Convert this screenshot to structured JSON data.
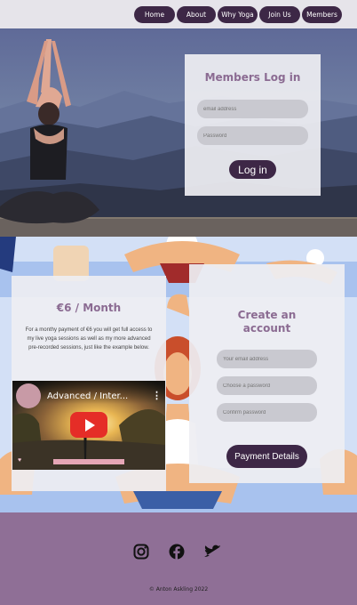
{
  "nav": {
    "items": [
      {
        "label": "Home"
      },
      {
        "label": "About"
      },
      {
        "label": "Why Yoga"
      },
      {
        "label": "Join Us"
      },
      {
        "label": "Members"
      }
    ]
  },
  "login": {
    "title": "Members Log in",
    "email_placeholder": "email address",
    "password_placeholder": "Password",
    "button_label": "Log in"
  },
  "pricing": {
    "title": "€6 / Month",
    "description": "For a monthy payment of €6 you will get full access to my live yoga sessions as well as my more advanced pre-recorded sessions, just like the example below.",
    "video_title": "Advanced / Inter..."
  },
  "signup": {
    "title_line1": "Create an",
    "title_line2": "account",
    "email_placeholder": "Your email address",
    "password_placeholder": "Choose a password",
    "confirm_placeholder": "Confirm password",
    "button_label": "Payment Details"
  },
  "footer": {
    "social_icons": [
      "instagram-icon",
      "facebook-icon",
      "twitter-icon"
    ],
    "copyright": "© Anton Askling 2022"
  },
  "colors": {
    "accent_dark": "#3d2746",
    "accent_purple": "#8f6f96",
    "title_purple": "#8b6b92",
    "youtube_red": "#e52d27"
  }
}
